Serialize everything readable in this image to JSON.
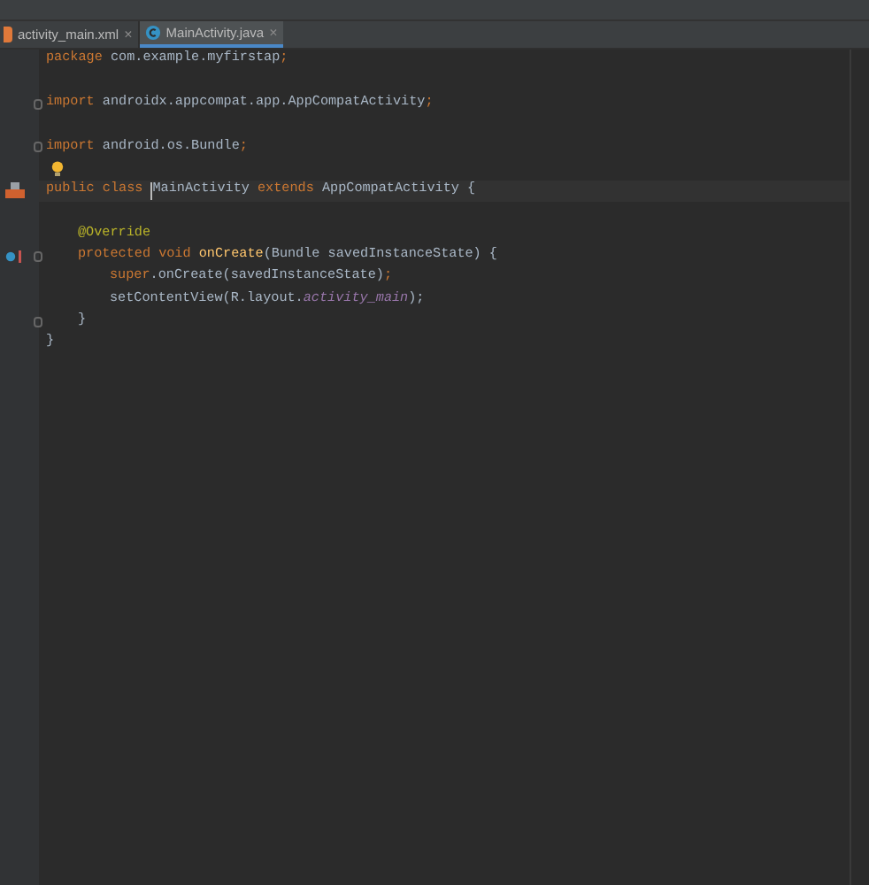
{
  "tabs": [
    {
      "label": "activity_main.xml",
      "kind": "xml",
      "close": "×",
      "selected": false
    },
    {
      "label": "MainActivity.java",
      "kind": "class",
      "close": "×",
      "selected": true
    }
  ],
  "lines": [
    {
      "kind": "code",
      "tokens": [
        {
          "text": "package ",
          "kind": "keyword"
        },
        {
          "text": "com.example.myfirstap",
          "kind": "plain"
        },
        {
          "text": ";",
          "kind": "keyword"
        }
      ]
    },
    {
      "kind": "blank"
    },
    {
      "kind": "code",
      "fold": true,
      "tokens": [
        {
          "text": "import ",
          "kind": "keyword"
        },
        {
          "text": "androidx.appcompat.app.AppCompatActivity",
          "kind": "plain"
        },
        {
          "text": ";",
          "kind": "keyword"
        }
      ]
    },
    {
      "kind": "blank"
    },
    {
      "kind": "code",
      "fold": true,
      "tokens": [
        {
          "text": "import ",
          "kind": "keyword"
        },
        {
          "text": "android.os.Bundle",
          "kind": "plain"
        },
        {
          "text": ";",
          "kind": "keyword"
        }
      ]
    },
    {
      "kind": "blank",
      "bulb": true
    },
    {
      "kind": "class",
      "current": true,
      "tokens": [
        {
          "text": "public class ",
          "kind": "keyword"
        },
        {
          "text": "MainActivity ",
          "kind": "plain",
          "caret": true
        },
        {
          "text": "extends ",
          "kind": "keyword"
        },
        {
          "text": "AppCompatActivity {",
          "kind": "plain"
        }
      ],
      "children": [
        {
          "kind": "blank"
        },
        {
          "kind": "code",
          "tokens": [
            {
              "text": "@Override",
              "kind": "annotation"
            }
          ]
        },
        {
          "kind": "override",
          "fold": true,
          "tokens": [
            {
              "text": "protected void ",
              "kind": "keyword"
            },
            {
              "text": "onCreate",
              "kind": "method"
            },
            {
              "text": "(Bundle savedInstanceState) {",
              "kind": "plain"
            }
          ],
          "children": [
            {
              "kind": "code",
              "tokens": [
                {
                  "text": "super",
                  "kind": "keyword"
                },
                {
                  "text": ".onCreate(savedInstanceState)",
                  "kind": "plain"
                },
                {
                  "text": ";",
                  "kind": "keyword"
                }
              ]
            },
            {
              "kind": "code",
              "tokens": [
                {
                  "text": "setContentView(R.layout.",
                  "kind": "plain"
                },
                {
                  "text": "activity_main",
                  "kind": "field"
                },
                {
                  "text": ");",
                  "kind": "plain"
                }
              ]
            }
          ]
        },
        {
          "kind": "code",
          "fold": true,
          "tokens": [
            {
              "text": "}",
              "kind": "plain"
            }
          ]
        }
      ]
    },
    {
      "kind": "code",
      "tokens": [
        {
          "text": "}",
          "kind": "plain"
        }
      ]
    }
  ]
}
